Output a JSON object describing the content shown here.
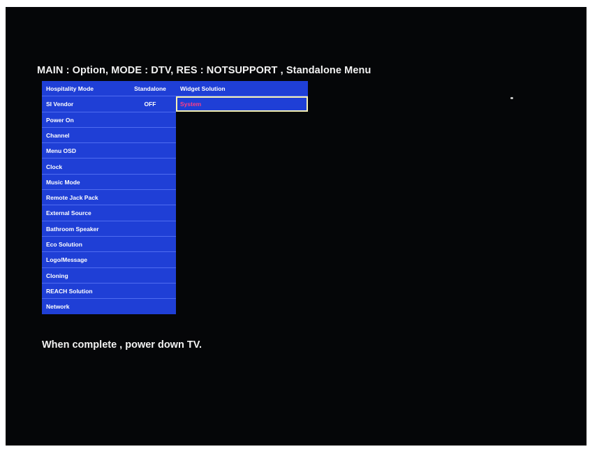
{
  "header": {
    "title": "MAIN : Option, MODE : DTV, RES : NOTSUPPORT , Standalone Menu"
  },
  "left_menu": {
    "items": [
      {
        "label": "Hospitality Mode",
        "value": "Standalone"
      },
      {
        "label": "SI Vendor",
        "value": "OFF"
      },
      {
        "label": "Power On",
        "value": ""
      },
      {
        "label": "Channel",
        "value": ""
      },
      {
        "label": "Menu OSD",
        "value": ""
      },
      {
        "label": "Clock",
        "value": ""
      },
      {
        "label": "Music Mode",
        "value": ""
      },
      {
        "label": "Remote Jack Pack",
        "value": ""
      },
      {
        "label": "External Source",
        "value": ""
      },
      {
        "label": "Bathroom Speaker",
        "value": ""
      },
      {
        "label": "Eco Solution",
        "value": ""
      },
      {
        "label": "Logo/Message",
        "value": ""
      },
      {
        "label": "Cloning",
        "value": ""
      },
      {
        "label": "REACH Solution",
        "value": ""
      },
      {
        "label": "Network",
        "value": ""
      }
    ]
  },
  "right_menu": {
    "items": [
      {
        "label": "Widget Solution",
        "selected": false
      },
      {
        "label": "System",
        "selected": true
      }
    ]
  },
  "footer": {
    "text": "When complete , power down TV."
  },
  "colors": {
    "screen_bg": "#050608",
    "menu_bg": "#1f3fd6",
    "row_divider": "#4f6cf0",
    "selected_text": "#ff3e86",
    "selected_border": "#f6f1b4"
  }
}
